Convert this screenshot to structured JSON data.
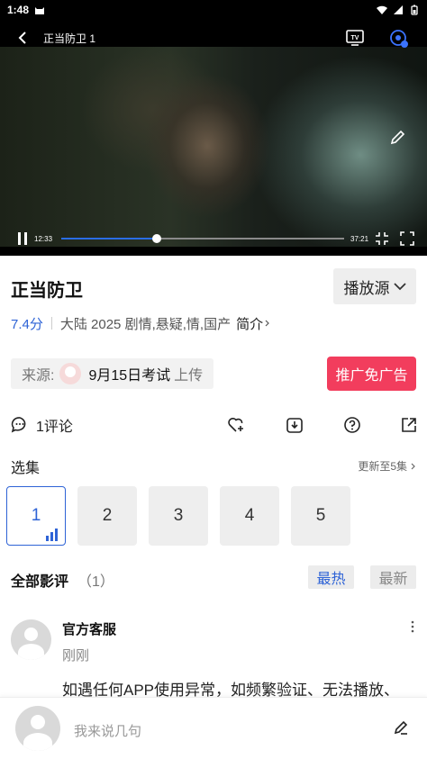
{
  "status_bar": {
    "time": "1:48",
    "icons": [
      "cat-icon",
      "wifi-icon",
      "signal-icon",
      "battery-icon"
    ]
  },
  "player": {
    "title": "正当防卫 1",
    "current_time": "12:33",
    "duration": "37:21",
    "progress": 0.336,
    "icons": [
      "back-icon",
      "tv-cast-icon",
      "share-settings-icon",
      "edit-icon",
      "pause-icon",
      "exit-fullscreen-icon",
      "fullscreen-icon"
    ]
  },
  "info": {
    "title": "正当防卫",
    "source_button": "播放源",
    "score": "7.4分",
    "meta": "大陆  2025  剧情,悬疑,情,国产",
    "intro": "简介",
    "from_label": "来源:",
    "from_name": "9月15日考试",
    "from_suffix": "上传",
    "promo_button": "推广免广告"
  },
  "actions": {
    "comment_label": "1评论"
  },
  "episodes": {
    "title": "选集",
    "update_text": "更新至5集",
    "items": [
      "1",
      "2",
      "3",
      "4",
      "5"
    ],
    "active": "1"
  },
  "reviews": {
    "title": "全部影评",
    "count": "（1）",
    "sort_hot": "最热",
    "sort_new": "最新",
    "items": [
      {
        "name": "官方客服",
        "time": "刚刚",
        "text": "如遇任何APP使用异常，如频繁验证、无法播放、"
      }
    ]
  },
  "composer": {
    "placeholder": "我来说几句"
  },
  "colors": {
    "accent": "#2e63d6",
    "promo": "#f23d5d"
  }
}
